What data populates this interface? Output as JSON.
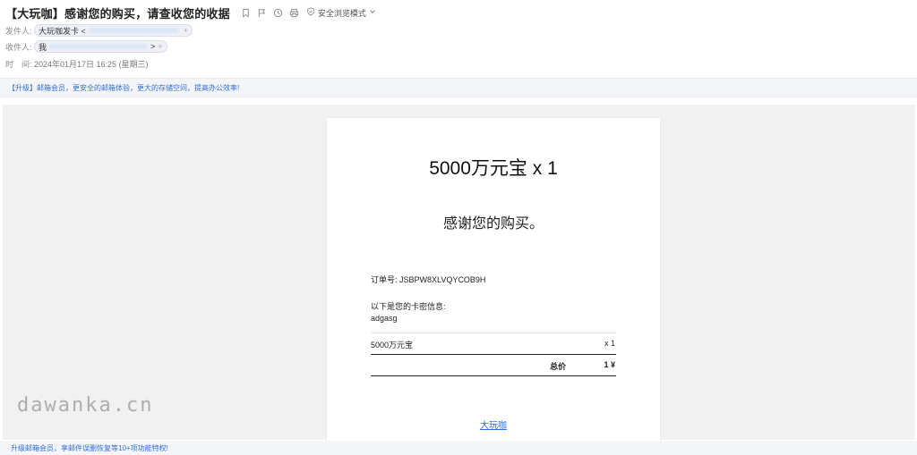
{
  "mail": {
    "subject": "【大玩咖】感谢您的购买，请查收您的收据",
    "safe_mode_label": "安全浏览模式",
    "from_label": "发件人:",
    "from_name": "大玩咖发卡 <",
    "from_plus": "+",
    "to_label": "收件人:",
    "to_name": "我",
    "to_tail": ">",
    "to_plus": "+",
    "time_label": "时　间:",
    "time_value": "2024年01月17日 16:25 (星期三)"
  },
  "upgrade_banner": "【升级】邮箱会员，更安全的邮箱体验，更大的存储空间，提高办公效率!",
  "receipt": {
    "product_title": "5000万元宝 x 1",
    "thanks": "感谢您的购买。",
    "order_label": "订单号:",
    "order_number": "JSBPW8XLVQYCOB9H",
    "card_info_label": "以下是您的卡密信息:",
    "card_info_value": "adgasg",
    "item_name": "5000万元宝",
    "item_qty": "x 1",
    "total_label": "总价",
    "total_value": "1 ¥",
    "footer_link": "大玩咖"
  },
  "watermark": "dawanka.cn",
  "bottom_banner": "升级邮箱会员，享邮件误删恢复等10+项功能特权!",
  "colors": {
    "accent": "#2f6fd8",
    "background": "#f1f1f1",
    "card": "#ffffff"
  },
  "icons": [
    "bookmark-icon",
    "flag-icon",
    "clock-icon",
    "print-icon",
    "shield-icon",
    "chevron-down-icon"
  ]
}
